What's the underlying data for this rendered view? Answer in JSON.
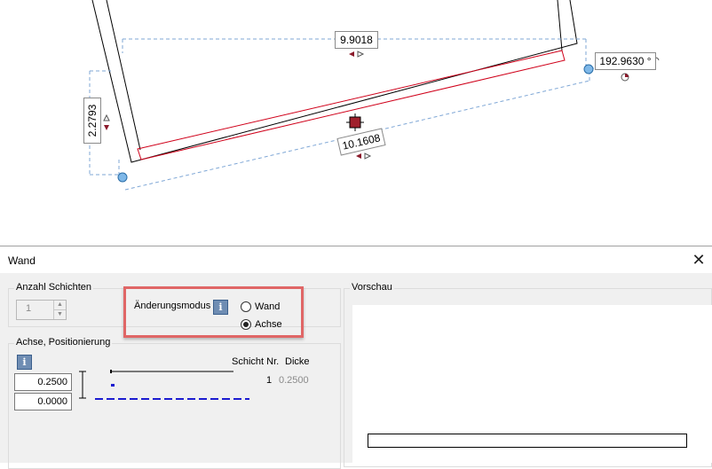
{
  "canvas": {
    "dim_top": "9.9018",
    "dim_bottom": "10.1608",
    "dim_left": "2.2793",
    "dim_angle": "192.9630 °"
  },
  "dialog": {
    "title": "Wand",
    "close_glyph": "✕",
    "anzahl_schichten": {
      "label": "Anzahl Schichten",
      "value": "1"
    },
    "aenderungsmodus": {
      "label": "Änderungsmodus",
      "info_glyph": "i",
      "options": [
        "Wand",
        "Achse"
      ],
      "selected": "Achse"
    },
    "achse": {
      "label": "Achse, Positionierung",
      "info_glyph": "i",
      "value_top": "0.2500",
      "value_bottom": "0.0000",
      "col_schicht": "Schicht Nr.",
      "col_dicke": "Dicke",
      "row_nr": "1",
      "row_dicke": "0.2500"
    },
    "vorschau": {
      "label": "Vorschau"
    }
  }
}
